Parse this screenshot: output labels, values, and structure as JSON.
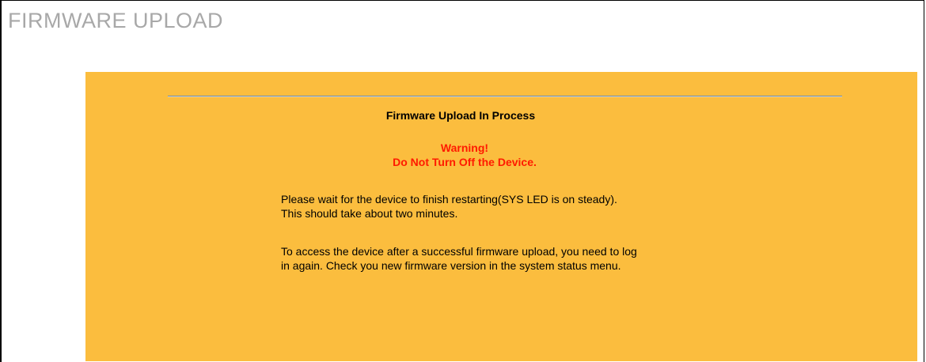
{
  "page": {
    "title": "FIRMWARE UPLOAD"
  },
  "panel": {
    "heading": "Firmware Upload In Process",
    "warning_title": "Warning!",
    "warning_message": "Do Not Turn Off the Device.",
    "wait_line_1": "Please wait for the device to finish restarting(SYS LED is on steady).",
    "wait_line_2": "This should take about two minutes.",
    "access_line_1": "To access the device after a successful firmware upload, you need to log",
    "access_line_2": "in again. Check you new firmware version in the system status menu."
  },
  "colors": {
    "panel_background": "#fbbd3e",
    "warning_text": "#ff1a00",
    "title_text": "#a8a8a8",
    "divider": "#6b8fb8"
  }
}
